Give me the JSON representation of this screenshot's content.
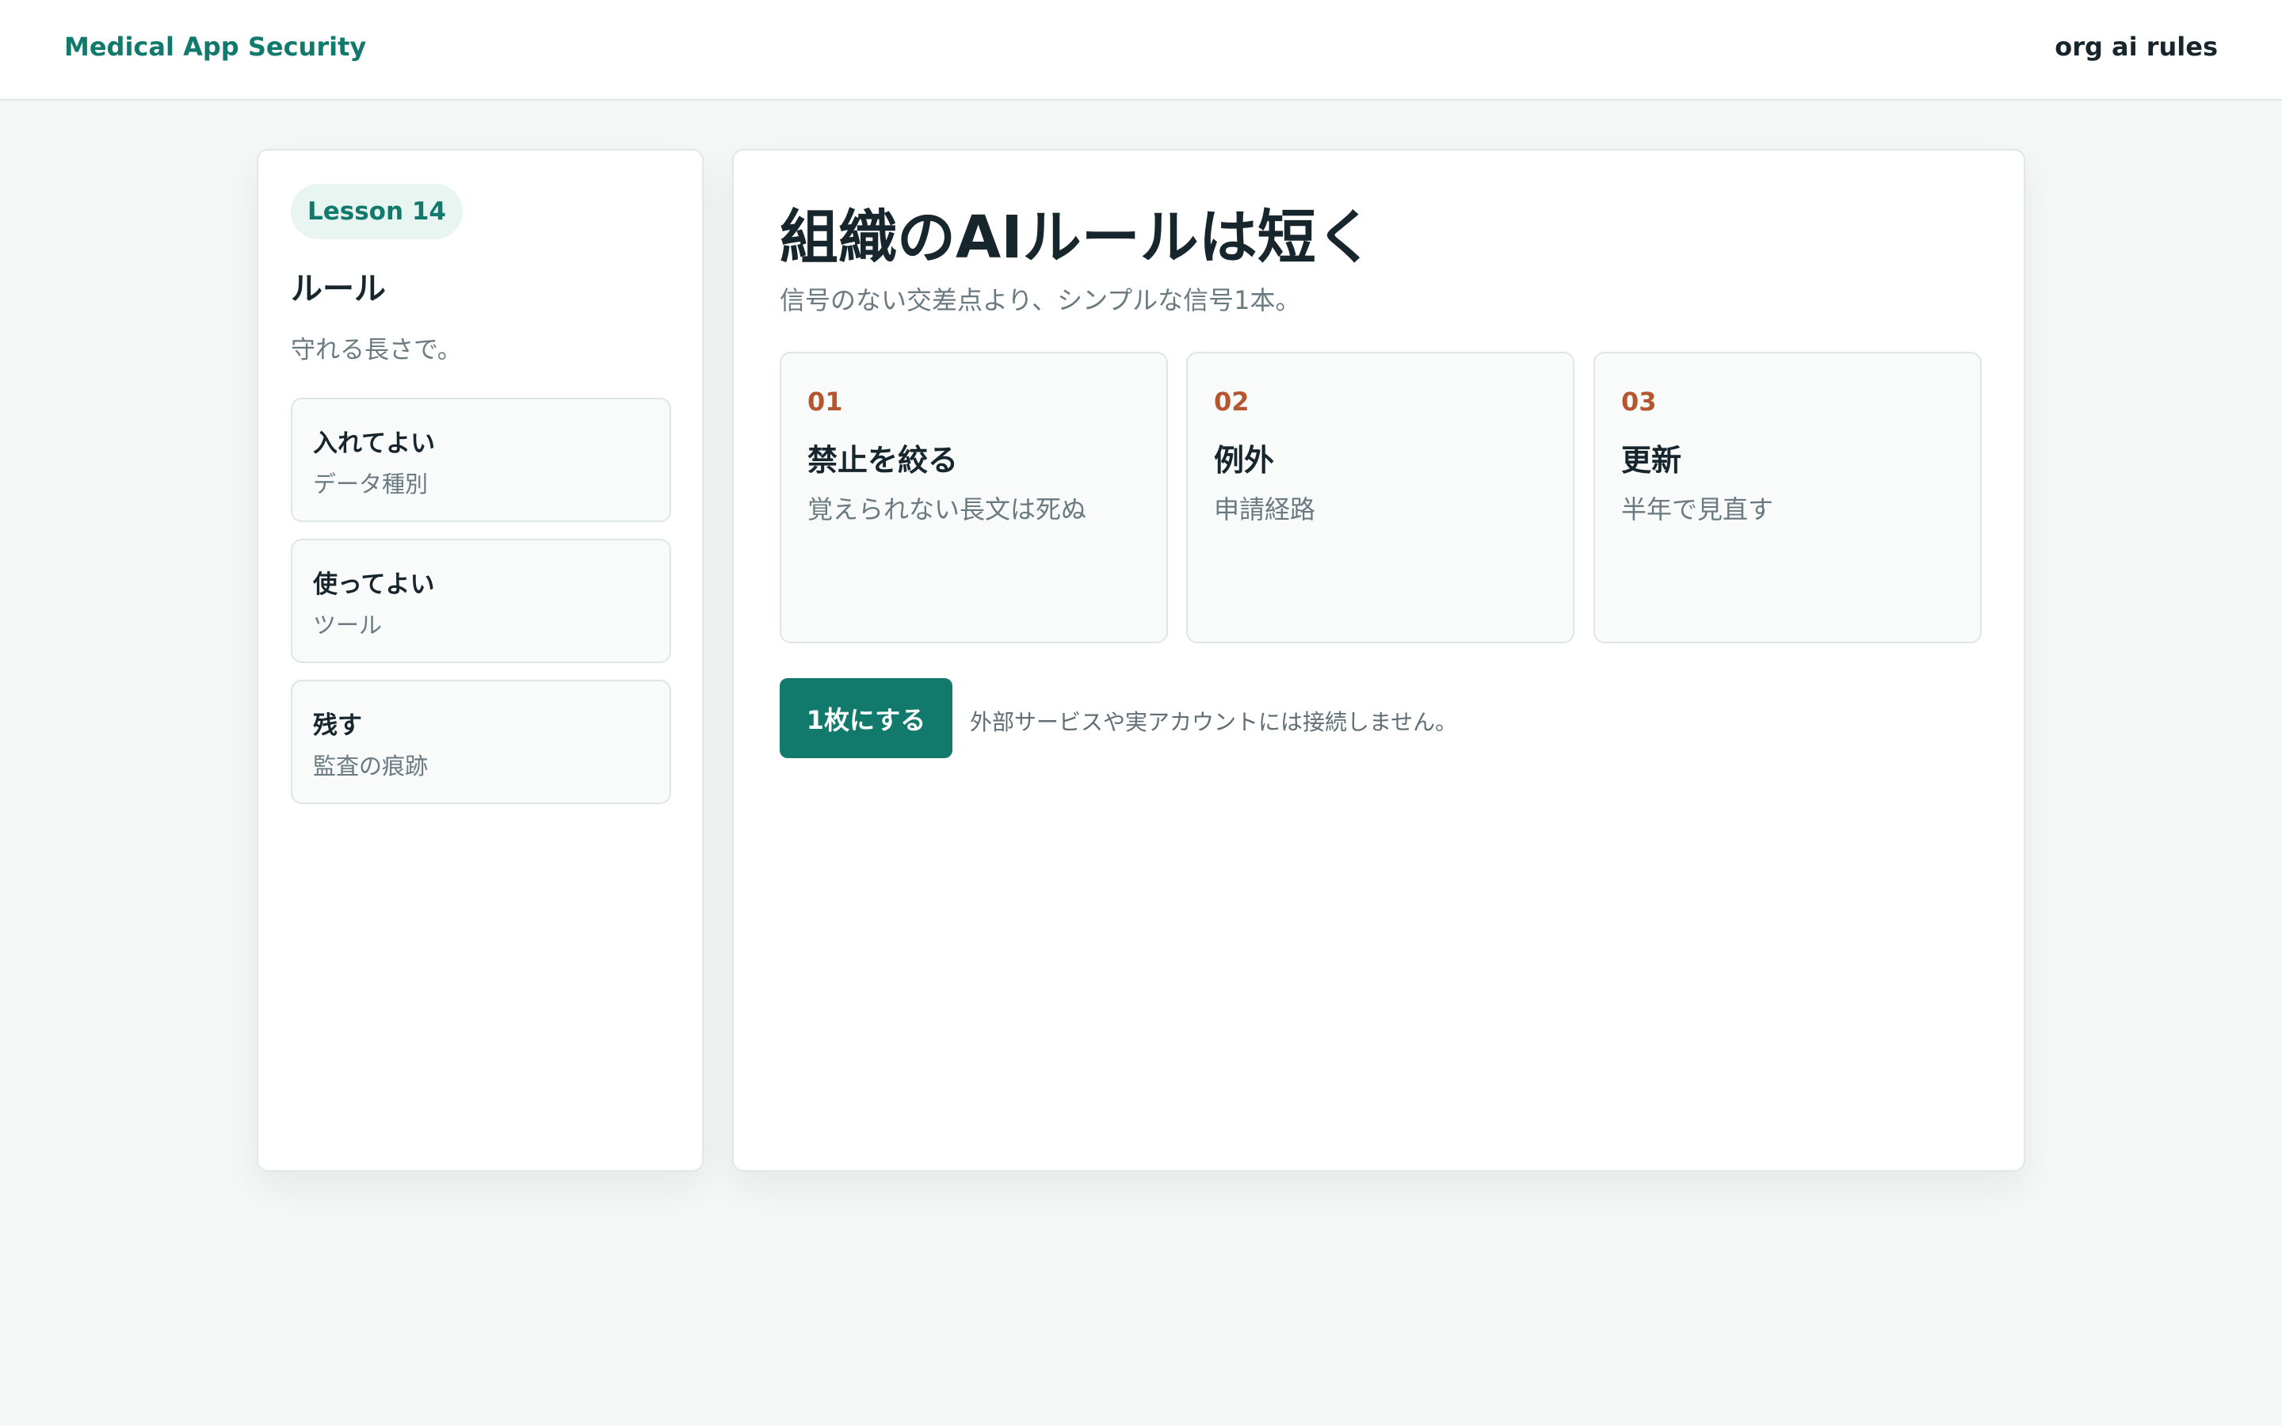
{
  "header": {
    "brand": "Medical App Security",
    "page_id": "org ai rules"
  },
  "sidebar": {
    "badge": "Lesson 14",
    "title": "ルール",
    "subtitle": "守れる長さで。",
    "items": [
      {
        "title": "入れてよい",
        "sub": "データ種別"
      },
      {
        "title": "使ってよい",
        "sub": "ツール"
      },
      {
        "title": "残す",
        "sub": "監査の痕跡"
      }
    ]
  },
  "main": {
    "title": "組織のAIルールは短く",
    "subtitle": "信号のない交差点より、シンプルな信号1本。",
    "cards": [
      {
        "num": "01",
        "title": "禁止を絞る",
        "sub": "覚えられない長文は死ぬ"
      },
      {
        "num": "02",
        "title": "例外",
        "sub": "申請経路"
      },
      {
        "num": "03",
        "title": "更新",
        "sub": "半年で見直す"
      }
    ],
    "cta_label": "1枚にする",
    "note": "外部サービスや実アカウントには接続しません。"
  },
  "colors": {
    "accent": "#117a6c",
    "number": "#b5562e",
    "background": "#f4f8f7"
  }
}
